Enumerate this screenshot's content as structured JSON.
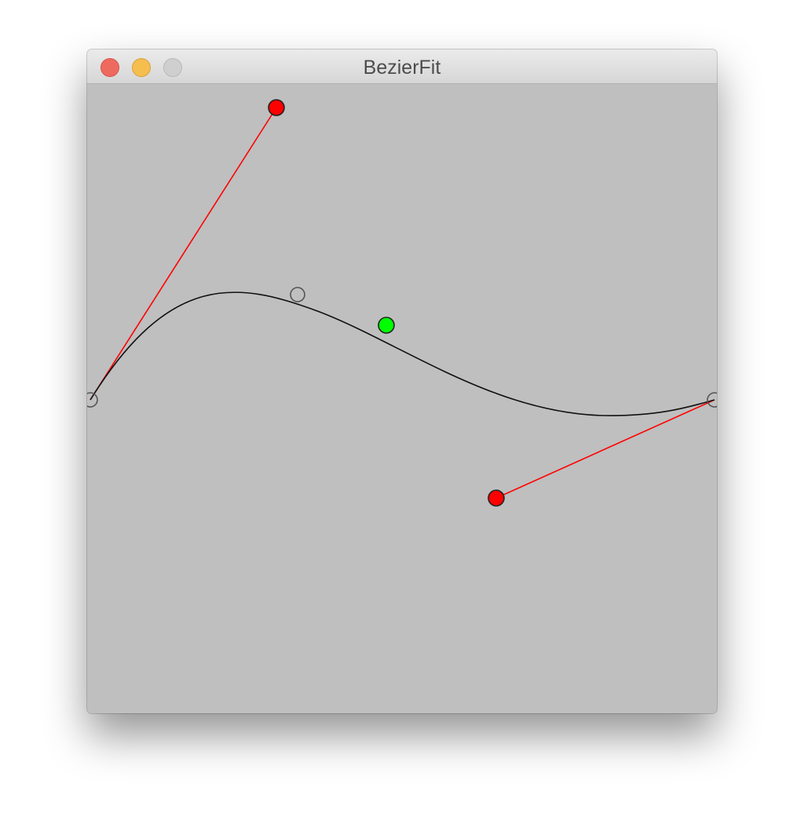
{
  "window": {
    "title": "BezierFit"
  },
  "colors": {
    "background": "#bfbfbf",
    "curve": "#000000",
    "control_handle_line": "#ff0000",
    "control_point_fill": "#ff0000",
    "midpoint_fill": "#00ff00",
    "anchor_point_stroke": "#555555"
  },
  "icons": {
    "close": "close-button",
    "minimize": "minimize-button",
    "zoom": "zoom-button"
  }
}
